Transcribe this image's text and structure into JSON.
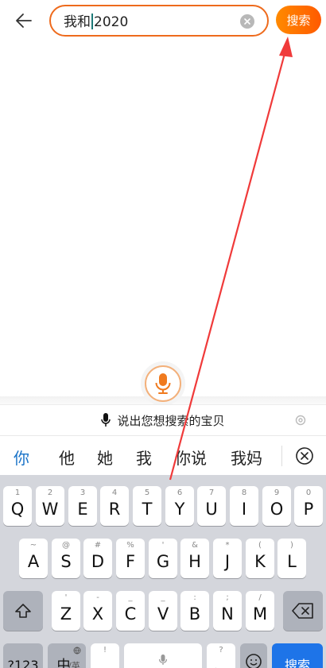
{
  "search": {
    "query_before_caret": "我和",
    "query_after_caret": "2020",
    "button_label": "搜索"
  },
  "voice": {
    "hint": "说出您想搜索的宝贝"
  },
  "candidates": [
    "你",
    "他",
    "她",
    "我",
    "你说",
    "我妈"
  ],
  "keyboard": {
    "row1": [
      {
        "hint": "1",
        "key": "Q"
      },
      {
        "hint": "2",
        "key": "W"
      },
      {
        "hint": "3",
        "key": "E"
      },
      {
        "hint": "4",
        "key": "R"
      },
      {
        "hint": "5",
        "key": "T"
      },
      {
        "hint": "6",
        "key": "Y"
      },
      {
        "hint": "7",
        "key": "U"
      },
      {
        "hint": "8",
        "key": "I"
      },
      {
        "hint": "9",
        "key": "O"
      },
      {
        "hint": "0",
        "key": "P"
      }
    ],
    "row2": [
      {
        "hint": "~",
        "key": "A"
      },
      {
        "hint": "@",
        "key": "S"
      },
      {
        "hint": "#",
        "key": "D"
      },
      {
        "hint": "%",
        "key": "F"
      },
      {
        "hint": "'",
        "key": "G"
      },
      {
        "hint": "&",
        "key": "H"
      },
      {
        "hint": "*",
        "key": "J"
      },
      {
        "hint": "(",
        "key": "K"
      },
      {
        "hint": ")",
        "key": "L"
      }
    ],
    "row3": [
      {
        "hint": "'",
        "key": "Z"
      },
      {
        "hint": "-",
        "key": "X"
      },
      {
        "hint": "_",
        "key": "C"
      },
      {
        "hint": "_",
        "key": "V"
      },
      {
        "hint": ":",
        "key": "B"
      },
      {
        "hint": ";",
        "key": "N"
      },
      {
        "hint": "/",
        "key": "M"
      }
    ],
    "num_label": "?123",
    "lang_label": "中",
    "lang_sub": "/英",
    "punct_label": "，",
    "punct_hint": "!",
    "question_label": "。",
    "question_hint": "?",
    "search_label": "搜索"
  },
  "colors": {
    "accent": "#ee6a1c",
    "search_button": "#ff6a00",
    "candidate_active": "#1a73c8",
    "arrow": "#f03a3a"
  }
}
